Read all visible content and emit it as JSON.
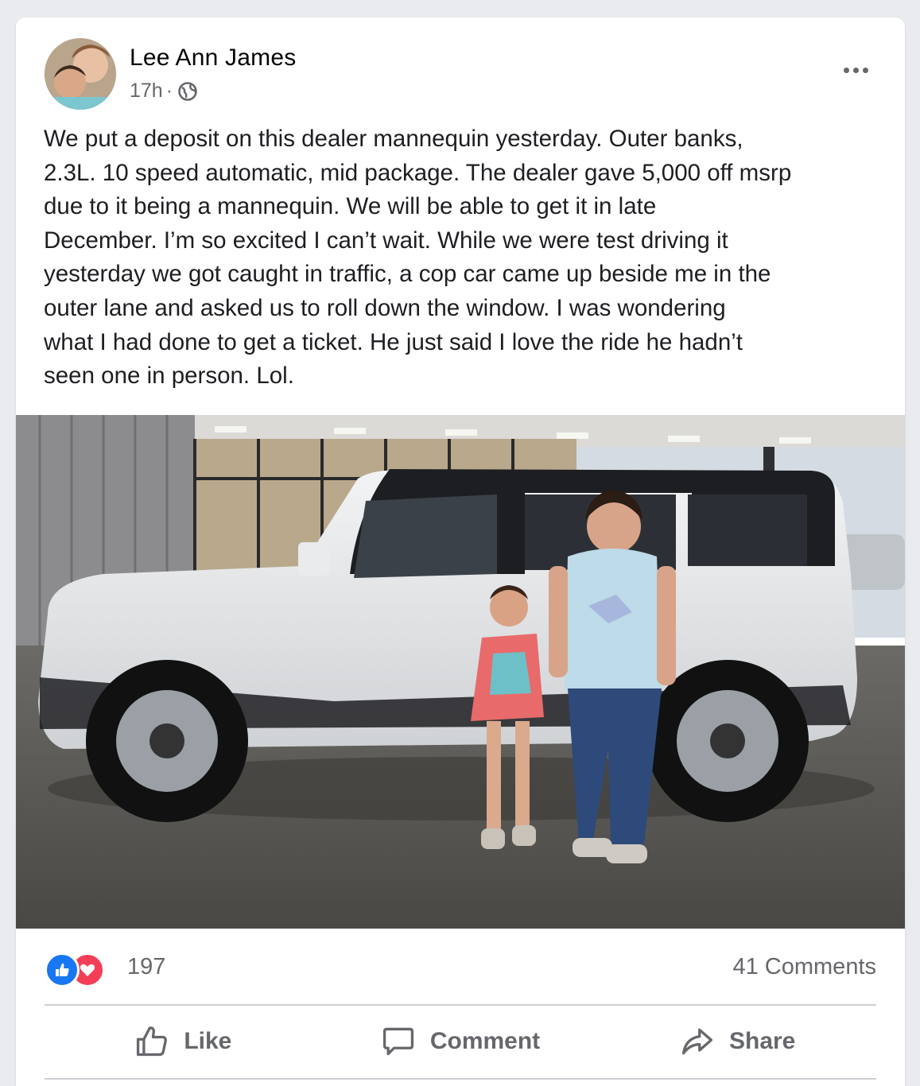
{
  "post": {
    "author": "Lee Ann James",
    "time": "17h",
    "separator": "·",
    "privacy_icon": "globe-icon",
    "more_icon": "more-options-icon",
    "text": "We put a deposit on this dealer mannequin yesterday. Outer banks,\n2.3L. 10 speed automatic, mid package. The dealer gave 5,000 off msrp\ndue to it being a mannequin. We will be able to get it in late\nDecember. I’m so excited I can’t wait. While we were test driving it\nyesterday we got caught in traffic, a cop car came up beside me in the\nouter lane and asked us to roll down the window. I was wondering\nwhat I had done to get a ticket. He just said I love the ride he hadn’t\nseen one in person. Lol."
  },
  "reactions": {
    "icons": [
      "like-reaction-icon",
      "love-reaction-icon"
    ],
    "count": "197",
    "comments": "41 Comments"
  },
  "actions": {
    "like": "Like",
    "comment": "Comment",
    "share": "Share"
  },
  "colors": {
    "like_blue": "#1877f2",
    "love_red": "#f33e58",
    "secondary_text": "#65676b",
    "car_body": "#e6e8ea",
    "car_roof": "#1d1e22"
  }
}
